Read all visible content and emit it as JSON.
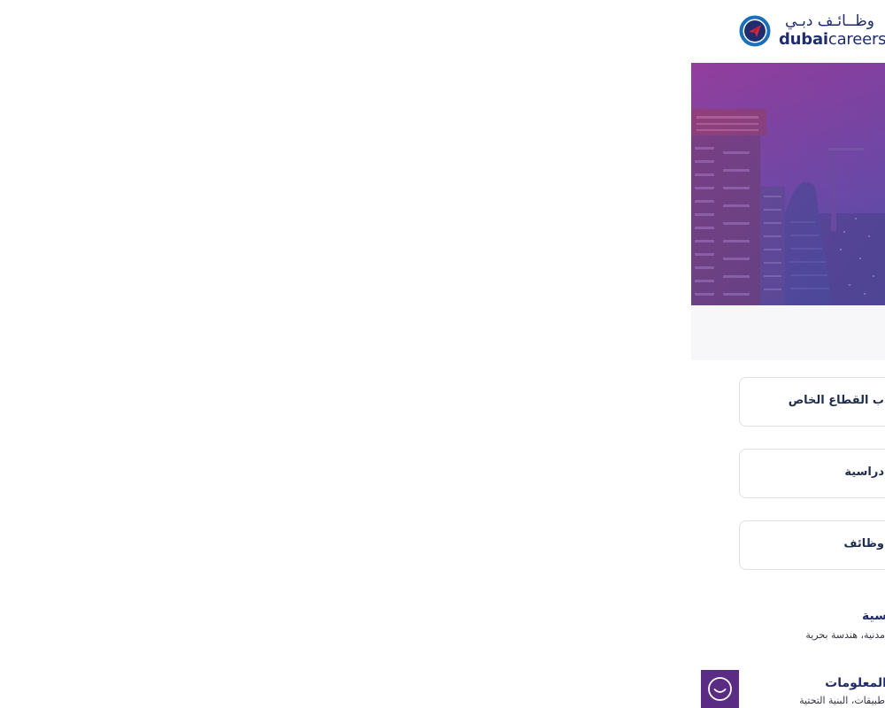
{
  "header": {
    "logo_arabic": "وظــائـف دبـي",
    "logo_en_bold": "dubai",
    "logo_en_light": "careers",
    "logo_icon": "paper-plane-icon",
    "brand_colors": {
      "navy": "#1f2d6e",
      "blue": "#1b6fb8",
      "red": "#d8263e",
      "purple": "#5b2c83"
    }
  },
  "hero": {
    "image": "dubai-skyline-photo",
    "overlay_color": "#7a3aa8"
  },
  "quick_links": [
    {
      "label": "ب القطاع الخاص"
    },
    {
      "label": "دراسية"
    },
    {
      "label": "وظائف"
    }
  ],
  "sectors": [
    {
      "title": "سية",
      "desc": "مدنية، هندسة بحرية"
    },
    {
      "title": "المعلومات",
      "desc": "طبيقات، البنية التحتية"
    }
  ],
  "chat": {
    "icon": "chat-smile-icon",
    "color": "#5b2c83"
  }
}
